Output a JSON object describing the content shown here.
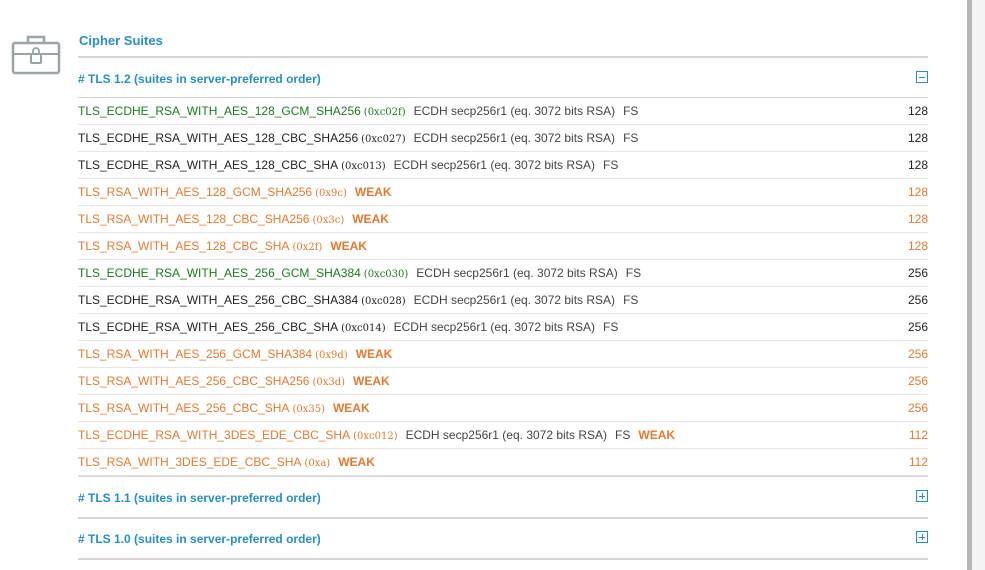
{
  "section": {
    "title": "Cipher Suites",
    "icon": "briefcase-lock-icon"
  },
  "groups": [
    {
      "title": "# TLS 1.2 (suites in server-preferred order)",
      "toggle": "minus",
      "expanded": true
    },
    {
      "title": "# TLS 1.1 (suites in server-preferred order)",
      "toggle": "plus",
      "expanded": false
    },
    {
      "title": "# TLS 1.0 (suites in server-preferred order)",
      "toggle": "plus",
      "expanded": false
    }
  ],
  "suites": [
    {
      "name": "TLS_ECDHE_RSA_WITH_AES_128_GCM_SHA256",
      "hex": "(0xc02f)",
      "kx": "ECDH secp256r1 (eq. 3072 bits RSA)",
      "fs": "FS",
      "weak": "",
      "bits": "128",
      "status": "strong"
    },
    {
      "name": "TLS_ECDHE_RSA_WITH_AES_128_CBC_SHA256",
      "hex": "(0xc027)",
      "kx": "ECDH secp256r1 (eq. 3072 bits RSA)",
      "fs": "FS",
      "weak": "",
      "bits": "128",
      "status": "normal"
    },
    {
      "name": "TLS_ECDHE_RSA_WITH_AES_128_CBC_SHA",
      "hex": "(0xc013)",
      "kx": "ECDH secp256r1 (eq. 3072 bits RSA)",
      "fs": "FS",
      "weak": "",
      "bits": "128",
      "status": "normal"
    },
    {
      "name": "TLS_RSA_WITH_AES_128_GCM_SHA256",
      "hex": "(0x9c)",
      "kx": "",
      "fs": "",
      "weak": "WEAK",
      "bits": "128",
      "status": "weak"
    },
    {
      "name": "TLS_RSA_WITH_AES_128_CBC_SHA256",
      "hex": "(0x3c)",
      "kx": "",
      "fs": "",
      "weak": "WEAK",
      "bits": "128",
      "status": "weak"
    },
    {
      "name": "TLS_RSA_WITH_AES_128_CBC_SHA",
      "hex": "(0x2f)",
      "kx": "",
      "fs": "",
      "weak": "WEAK",
      "bits": "128",
      "status": "weak"
    },
    {
      "name": "TLS_ECDHE_RSA_WITH_AES_256_GCM_SHA384",
      "hex": "(0xc030)",
      "kx": "ECDH secp256r1 (eq. 3072 bits RSA)",
      "fs": "FS",
      "weak": "",
      "bits": "256",
      "status": "strong"
    },
    {
      "name": "TLS_ECDHE_RSA_WITH_AES_256_CBC_SHA384",
      "hex": "(0xc028)",
      "kx": "ECDH secp256r1 (eq. 3072 bits RSA)",
      "fs": "FS",
      "weak": "",
      "bits": "256",
      "status": "normal"
    },
    {
      "name": "TLS_ECDHE_RSA_WITH_AES_256_CBC_SHA",
      "hex": "(0xc014)",
      "kx": "ECDH secp256r1 (eq. 3072 bits RSA)",
      "fs": "FS",
      "weak": "",
      "bits": "256",
      "status": "normal"
    },
    {
      "name": "TLS_RSA_WITH_AES_256_GCM_SHA384",
      "hex": "(0x9d)",
      "kx": "",
      "fs": "",
      "weak": "WEAK",
      "bits": "256",
      "status": "weak"
    },
    {
      "name": "TLS_RSA_WITH_AES_256_CBC_SHA256",
      "hex": "(0x3d)",
      "kx": "",
      "fs": "",
      "weak": "WEAK",
      "bits": "256",
      "status": "weak"
    },
    {
      "name": "TLS_RSA_WITH_AES_256_CBC_SHA",
      "hex": "(0x35)",
      "kx": "",
      "fs": "",
      "weak": "WEAK",
      "bits": "256",
      "status": "weak"
    },
    {
      "name": "TLS_ECDHE_RSA_WITH_3DES_EDE_CBC_SHA",
      "hex": "(0xc012)",
      "kx": "ECDH secp256r1 (eq. 3072 bits RSA)",
      "fs": "FS",
      "weak": "WEAK",
      "bits": "112",
      "status": "weak"
    },
    {
      "name": "TLS_RSA_WITH_3DES_EDE_CBC_SHA",
      "hex": "(0xa)",
      "kx": "",
      "fs": "",
      "weak": "WEAK",
      "bits": "112",
      "status": "weak"
    }
  ],
  "colors": {
    "accent": "#2a8ec2",
    "strong": "#1c7a1c",
    "weak": "#e07a34",
    "rule": "#d5d5d5"
  }
}
